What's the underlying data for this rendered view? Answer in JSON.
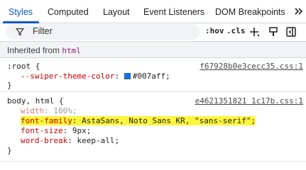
{
  "tabs": [
    {
      "label": "Styles",
      "active": true
    },
    {
      "label": "Computed",
      "active": false
    },
    {
      "label": "Layout",
      "active": false
    },
    {
      "label": "Event Listeners",
      "active": false
    },
    {
      "label": "DOM Breakpoints",
      "active": false
    }
  ],
  "toolbar": {
    "filter_placeholder": "Filter",
    "hov_label": ":hov",
    "cls_label": ".cls"
  },
  "inherited": {
    "prefix": "Inherited from ",
    "element": "html"
  },
  "rules": [
    {
      "selector": ":root {",
      "source": "f67928b0e3cecc35.css:1",
      "declarations": [
        {
          "name": "--swiper-theme-color",
          "colon": ": ",
          "value": "#007aff",
          "semicolon": ";",
          "swatch": "#007aff"
        }
      ],
      "close": "}"
    },
    {
      "selector": "body, html {",
      "source": "e4621351821 1c17b.css:1",
      "declarations": [
        {
          "name": "width",
          "colon": ": ",
          "value": "100%",
          "semicolon": ";"
        },
        {
          "name": "font-family",
          "colon": ": ",
          "value": "AstaSans, Noto Sans KR, \"sans-serif\"",
          "semicolon": ";"
        },
        {
          "name": "font-size",
          "colon": ": ",
          "value": "9px",
          "semicolon": ";"
        },
        {
          "name": "word-break",
          "colon": ": ",
          "value": "keep-all",
          "semicolon": ";"
        }
      ],
      "close": "}"
    }
  ],
  "colors": {
    "accent": "#0b57d0",
    "property_name": "#c80000",
    "highlight": "#fef63a",
    "inherited_link": "#8b1d80"
  }
}
